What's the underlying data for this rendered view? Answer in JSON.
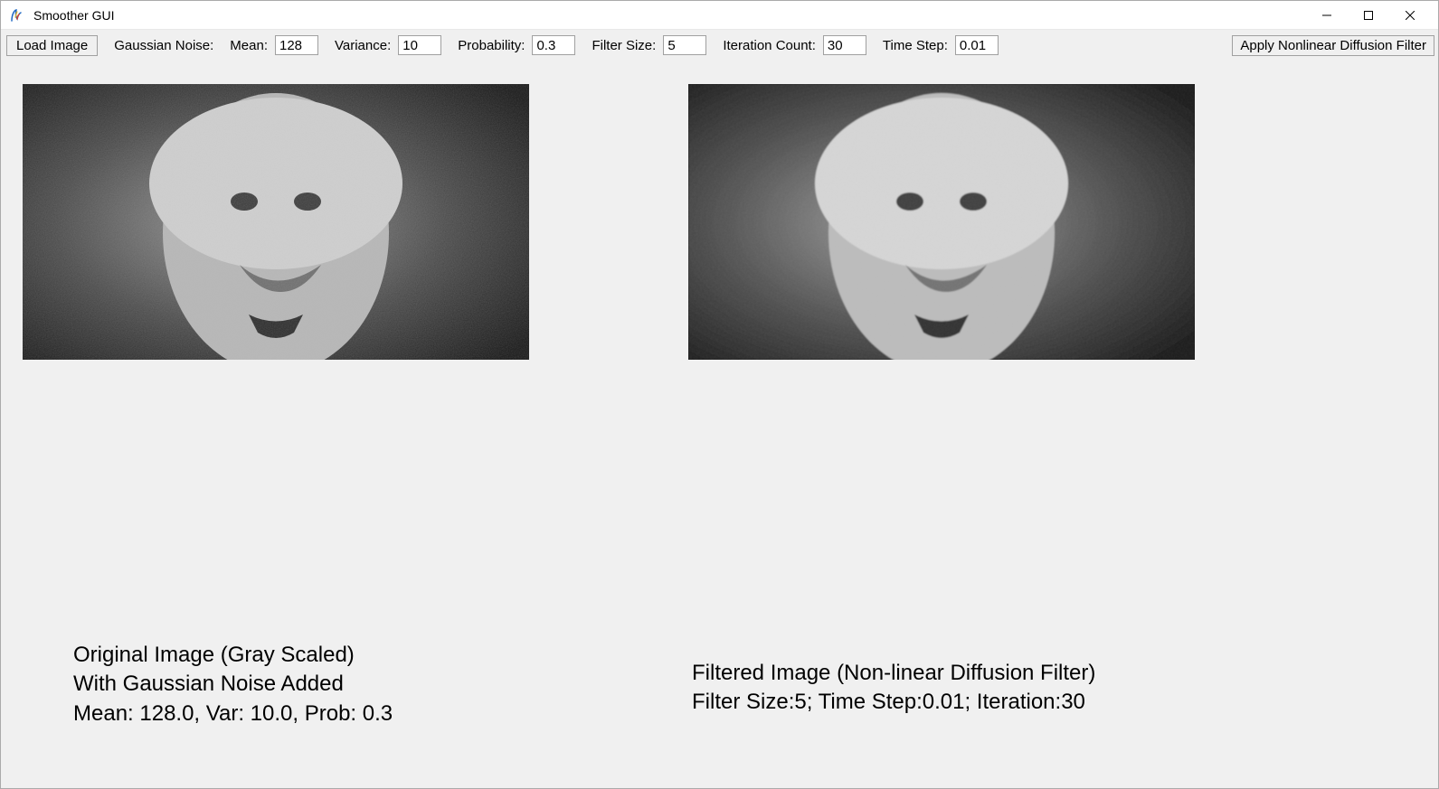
{
  "window": {
    "title": "Smoother GUI"
  },
  "toolbar": {
    "load_button_label": "Load Image",
    "gaussian_noise_label": "Gaussian Noise:",
    "mean_label": "Mean:",
    "mean_value": "128",
    "variance_label": "Variance:",
    "variance_value": "10",
    "probability_label": "Probability:",
    "probability_value": "0.3",
    "filter_size_label": "Filter Size:",
    "filter_size_value": "5",
    "iteration_count_label": "Iteration Count:",
    "iteration_count_value": "30",
    "time_step_label": "Time Step:",
    "time_step_value": "0.01",
    "apply_button_label": "Apply Nonlinear Diffusion Filter"
  },
  "captions": {
    "left_line1": "Original Image (Gray Scaled)",
    "left_line2": "With Gaussian Noise Added",
    "left_line3": "Mean: 128.0, Var: 10.0, Prob: 0.3",
    "right_line1": "Filtered Image (Non-linear Diffusion Filter)",
    "right_line2": "Filter Size:5; Time Step:0.01; Iteration:30"
  }
}
